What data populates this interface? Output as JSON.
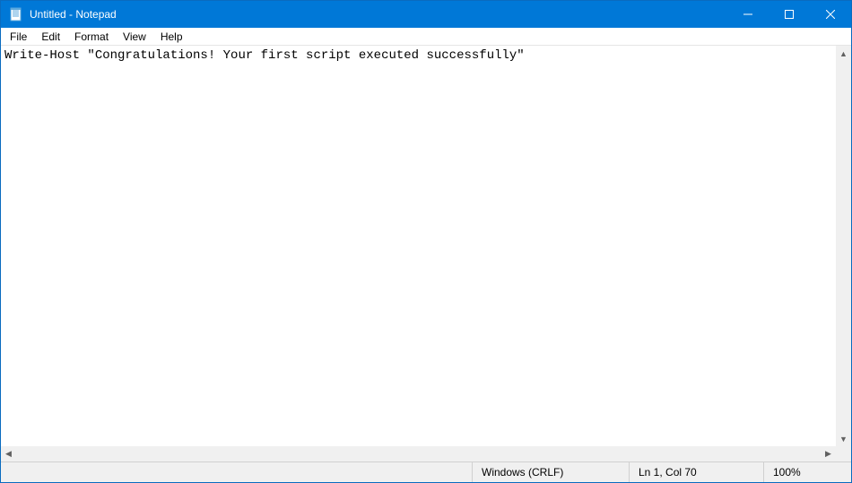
{
  "titlebar": {
    "title": "Untitled - Notepad"
  },
  "menu": {
    "file": "File",
    "edit": "Edit",
    "format": "Format",
    "view": "View",
    "help": "Help"
  },
  "editor": {
    "content": "Write-Host \"Congratulations! Your first script executed successfully\""
  },
  "status": {
    "encoding": "Windows (CRLF)",
    "position": "Ln 1, Col 70",
    "zoom": "100%"
  }
}
